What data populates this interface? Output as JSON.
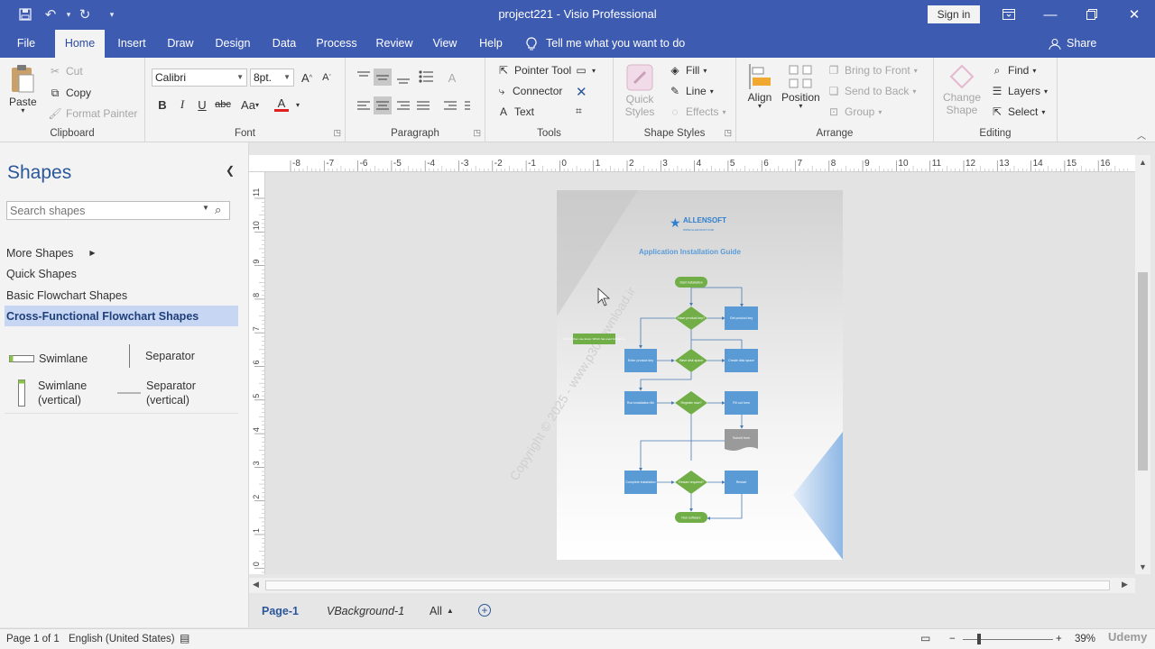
{
  "window": {
    "title": "project221  -  Visio Professional",
    "sign_in": "Sign in"
  },
  "tabs": [
    "File",
    "Home",
    "Insert",
    "Draw",
    "Design",
    "Data",
    "Process",
    "Review",
    "View",
    "Help"
  ],
  "active_tab": "Home",
  "tell_me": "Tell me what you want to do",
  "share": "Share",
  "ribbon": {
    "clipboard": {
      "label": "Clipboard",
      "paste": "Paste",
      "cut": "Cut",
      "copy": "Copy",
      "format_painter": "Format Painter"
    },
    "font": {
      "label": "Font",
      "family": "Calibri",
      "size": "8pt."
    },
    "paragraph": {
      "label": "Paragraph"
    },
    "tools": {
      "label": "Tools",
      "pointer": "Pointer Tool",
      "connector": "Connector",
      "text": "Text"
    },
    "shape_styles": {
      "label": "Shape Styles",
      "quick_styles": "Quick Styles",
      "fill": "Fill",
      "line": "Line",
      "effects": "Effects"
    },
    "arrange": {
      "label": "Arrange",
      "align": "Align",
      "position": "Position",
      "bring_front": "Bring to Front",
      "send_back": "Send to Back",
      "group": "Group"
    },
    "editing": {
      "label": "Editing",
      "change_shape": "Change Shape",
      "find": "Find",
      "layers": "Layers",
      "select": "Select"
    }
  },
  "shapes_pane": {
    "title": "Shapes",
    "search_placeholder": "Search shapes",
    "more_shapes": "More Shapes",
    "stencils": [
      "Quick Shapes",
      "Basic Flowchart Shapes",
      "Cross-Functional Flowchart Shapes"
    ],
    "masters": {
      "swimlane": "Swimlane",
      "separator": "Separator",
      "swimlane_v1": "Swimlane",
      "swimlane_v2": "(vertical)",
      "separator_v1": "Separator",
      "separator_v2": "(vertical)"
    }
  },
  "rulers": {
    "h_ticks": [
      "-8",
      "-7",
      "-6",
      "-5",
      "-4",
      "-3",
      "-2",
      "-1",
      "0",
      "1",
      "2",
      "3",
      "4",
      "5",
      "6",
      "7",
      "8",
      "9",
      "10",
      "11",
      "12",
      "13",
      "14",
      "15",
      "16"
    ],
    "v_ticks": [
      "11",
      "10",
      "9",
      "8",
      "7",
      "6",
      "5",
      "4",
      "3",
      "2",
      "1",
      "0"
    ]
  },
  "diagram": {
    "logo": "ALLENSOFT",
    "logo_url": "WWW.ALLENSOFT.COM",
    "heading": "Application Installation Guide",
    "watermark": "Copyright © 2025 - www.p30download.ir",
    "nodes": {
      "start": "Start installation",
      "q_key": "Have product key?",
      "get_key": "Get product key",
      "note": "You can then use Excel. Which has used for Signup.",
      "enter_key": "Enter product key",
      "q_disk": "Have disk space",
      "create_space": "Create disk space",
      "run_file": "Run installation file",
      "q_register": "Register now?",
      "fill_form": "Fill out form",
      "submit": "Submit form",
      "complete": "Complete installation",
      "q_restart": "Restart required?",
      "restart": "Restart",
      "run_software": "Run software"
    }
  },
  "page_tabs": {
    "page1": "Page-1",
    "bg": "VBackground-1",
    "all": "All"
  },
  "status": {
    "page": "Page 1 of 1",
    "language": "English (United States)",
    "zoom": "39%",
    "brand": "Udemy"
  },
  "colors": {
    "titlebar": "#3e5bb2",
    "flow_green": "#72ae48",
    "flow_blue": "#5b9bd5",
    "accent_blue": "#2b579a"
  }
}
